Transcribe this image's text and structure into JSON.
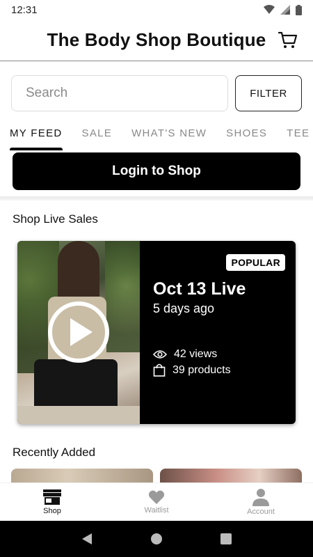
{
  "status_bar": {
    "time": "12:31",
    "icons": [
      "wifi-icon",
      "signal-icon",
      "battery-icon"
    ]
  },
  "header": {
    "title": "The Body Shop Boutique",
    "cart_icon": "cart-icon"
  },
  "search": {
    "placeholder": "Search",
    "value": "",
    "filter_label": "FILTER"
  },
  "tabs": [
    {
      "label": "MY FEED",
      "active": true
    },
    {
      "label": "SALE",
      "active": false
    },
    {
      "label": "WHAT'S NEW",
      "active": false
    },
    {
      "label": "SHOES",
      "active": false
    },
    {
      "label": "TEE",
      "active": false
    }
  ],
  "login_button": {
    "label": "Login to Shop"
  },
  "live_sales": {
    "section_title": "Shop Live Sales",
    "card": {
      "badge": "POPULAR",
      "title": "Oct 13 Live",
      "subtitle": "5 days ago",
      "views": "42 views",
      "products": "39 products",
      "play_icon": "play-icon"
    }
  },
  "recently_added": {
    "section_title": "Recently Added"
  },
  "bottom_nav": [
    {
      "label": "Shop",
      "icon": "store-icon",
      "active": true
    },
    {
      "label": "Waitlist",
      "icon": "heart-icon",
      "active": false
    },
    {
      "label": "Account",
      "icon": "person-icon",
      "active": false
    }
  ],
  "colors": {
    "accent": "#000000",
    "background": "#ffffff",
    "inactive": "#9a9a9a"
  }
}
